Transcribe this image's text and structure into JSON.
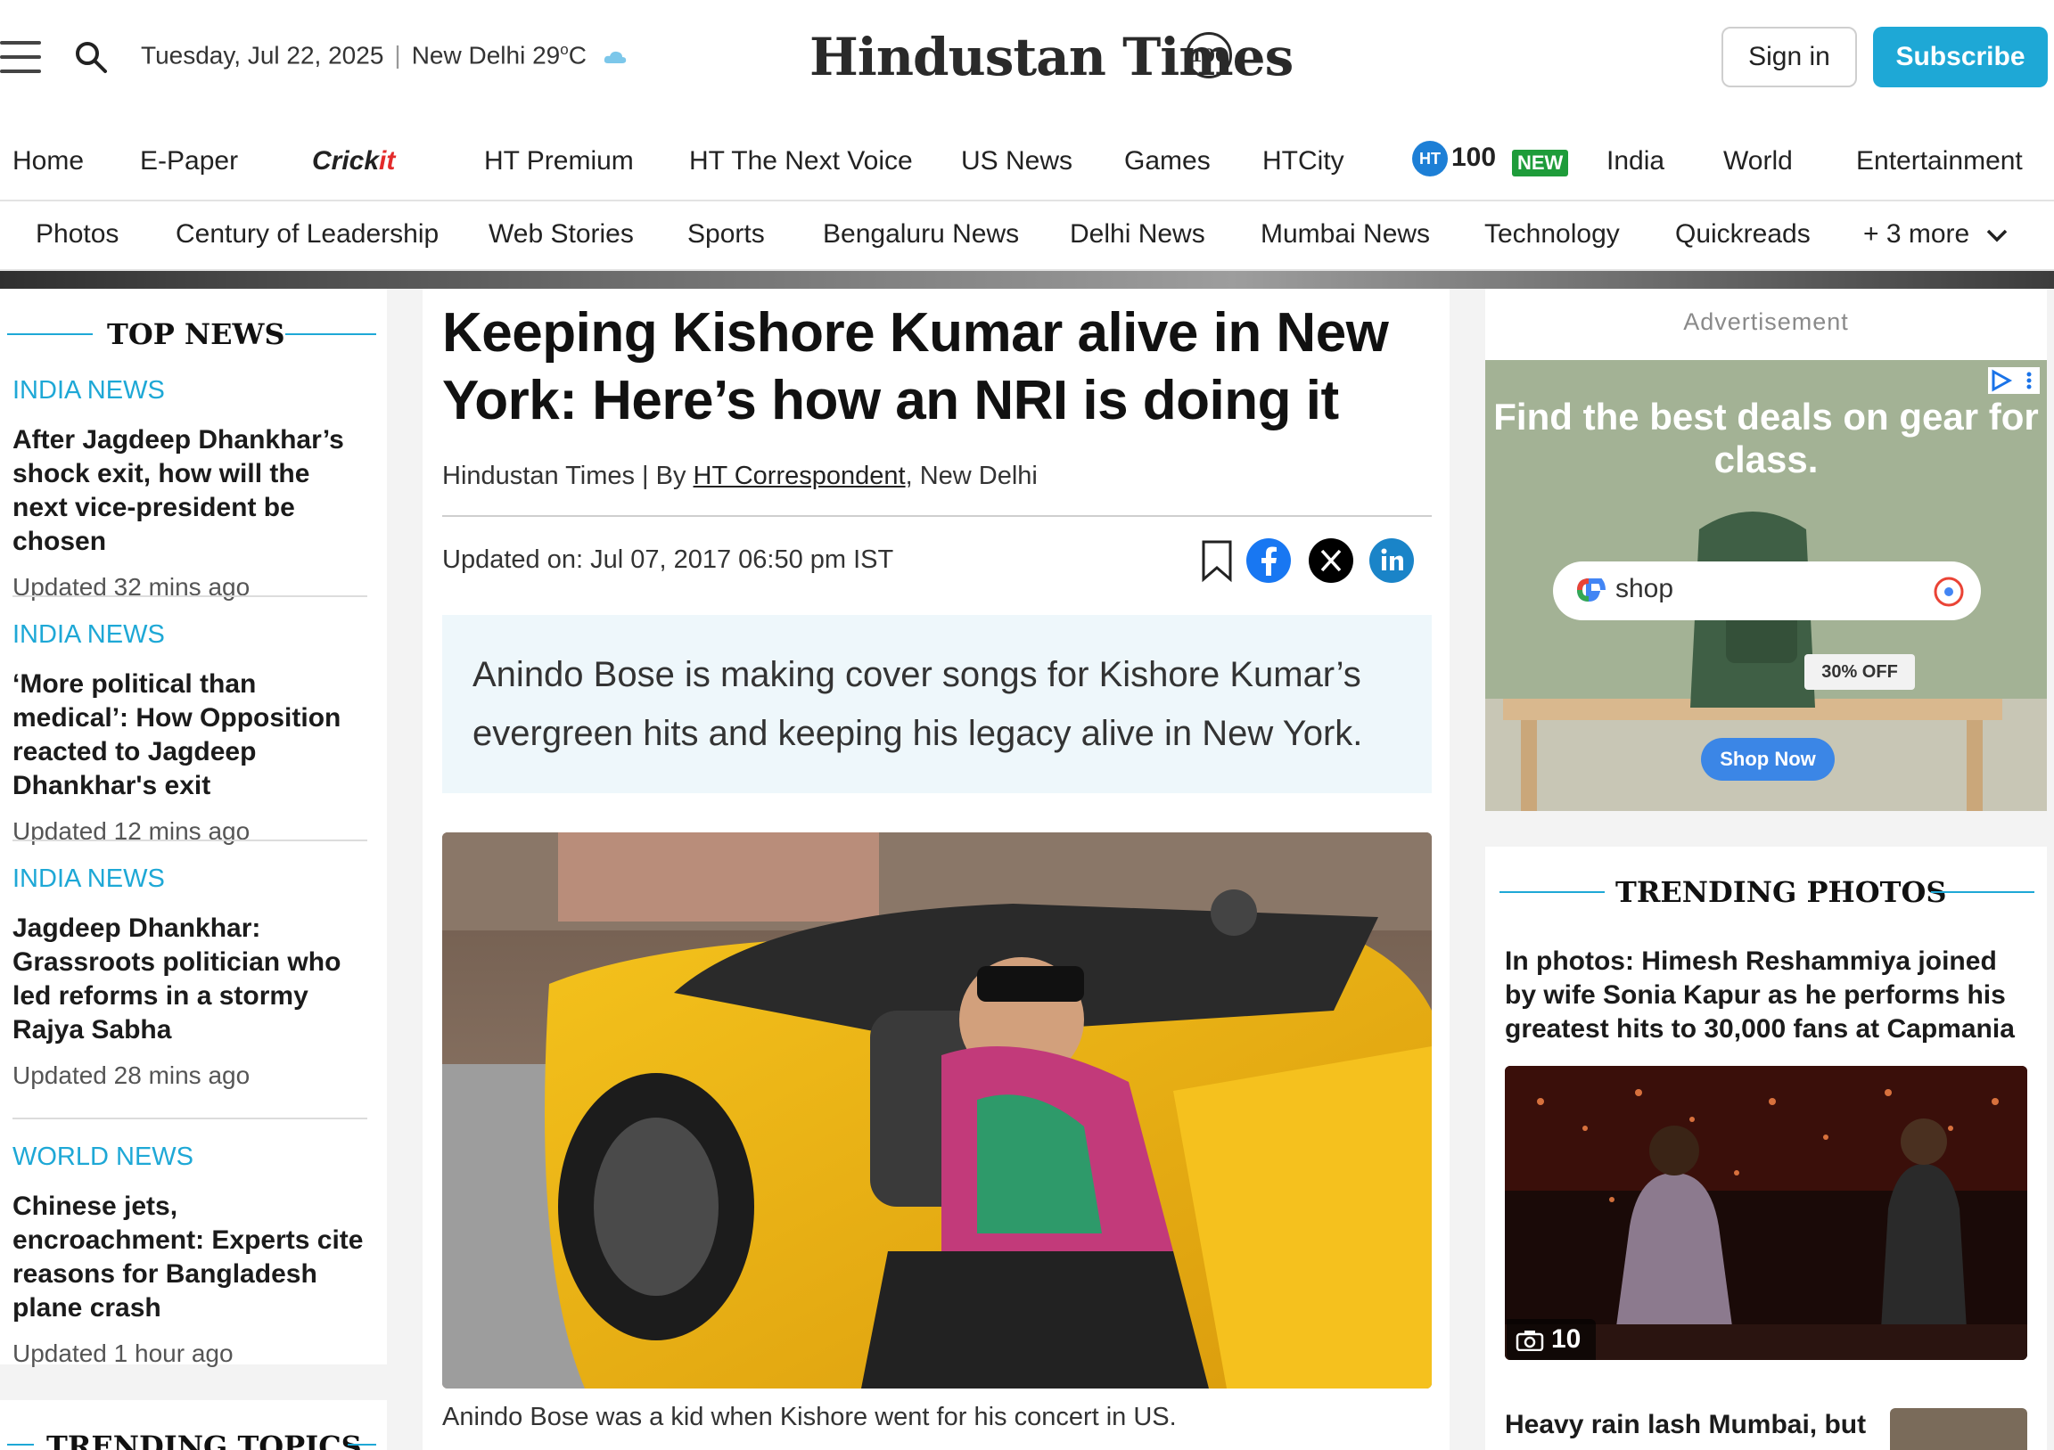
{
  "header": {
    "date": "Tuesday, Jul 22, 2025",
    "location": "New Delhi 29",
    "temp_unit": "C",
    "temp_degree": "o",
    "logo": "Hindustan Times",
    "logo_badge": "100",
    "signin_label": "Sign in",
    "subscribe_label": "Subscribe",
    "icons": {
      "menu": "hamburger-icon",
      "search": "search-icon",
      "weather": "cloud-icon"
    },
    "accent": "#1ea8d6"
  },
  "nav_primary": {
    "home": "Home",
    "epaper": "E-Paper",
    "cricket": "Crick",
    "cricket_suffix": "it",
    "premium": "HT Premium",
    "next_voice": "HT The Next Voice",
    "us_news": "US News",
    "games": "Games",
    "htcity": "HTCity",
    "ht100_badge": "HT",
    "ht100": "100",
    "new_badge": "NEW",
    "india": "India",
    "world": "World",
    "entertainment": "Entertainment"
  },
  "nav_secondary": {
    "photos": "Photos",
    "century": "Century of Leadership",
    "web_stories": "Web Stories",
    "sports": "Sports",
    "bengaluru": "Bengaluru News",
    "delhi": "Delhi News",
    "mumbai": "Mumbai News",
    "technology": "Technology",
    "quickreads": "Quickreads",
    "more": "+ 3 more"
  },
  "top_news": {
    "title": "TOP NEWS",
    "items": [
      {
        "category": "INDIA NEWS",
        "headline": "After Jagdeep Dhankhar’s shock exit, how will the next vice-president be chosen",
        "updated": "Updated 32 mins ago"
      },
      {
        "category": "INDIA NEWS",
        "headline": "‘More political than medical’: How Opposition reacted to Jagdeep Dhankhar's exit",
        "updated": "Updated 12 mins ago"
      },
      {
        "category": "INDIA NEWS",
        "headline": "Jagdeep Dhankhar: Grassroots politician who led reforms in a stormy Rajya Sabha",
        "updated": "Updated 28 mins ago"
      },
      {
        "category": "WORLD NEWS",
        "headline": "Chinese jets, encroachment: Experts cite reasons for Bangladesh plane crash",
        "updated": "Updated 1 hour ago"
      }
    ],
    "next_section": "TRENDING TOPICS"
  },
  "article": {
    "headline": "Keeping Kishore Kumar alive in New York: Here’s how an NRI is doing it",
    "source": "Hindustan Times | By ",
    "author": "HT Correspondent",
    "location": ", New Delhi",
    "updated": "Updated on: Jul 07, 2017 06:50 pm IST",
    "summary": "Anindo Bose is making cover songs for Kishore Kumar’s evergreen hits and keeping his legacy alive in New York.",
    "caption": "Anindo Bose was a kid when Kishore went for his concert in US.",
    "share_icons": [
      "bookmark-icon",
      "facebook-icon",
      "x-icon",
      "linkedin-icon"
    ]
  },
  "ad": {
    "label": "Advertisement",
    "headline": "Find the best deals on gear for class.",
    "search_text": "shop",
    "discount": "30% OFF",
    "cta": "Shop Now"
  },
  "trending_photos": {
    "title": "TRENDING PHOTOS",
    "headline": "In photos: Himesh Reshammiya joined by wife Sonia Kapur as he performs his greatest hits to 30,000 fans at Capmania",
    "count": "10",
    "next_headline": "Heavy rain lash Mumbai, but"
  }
}
